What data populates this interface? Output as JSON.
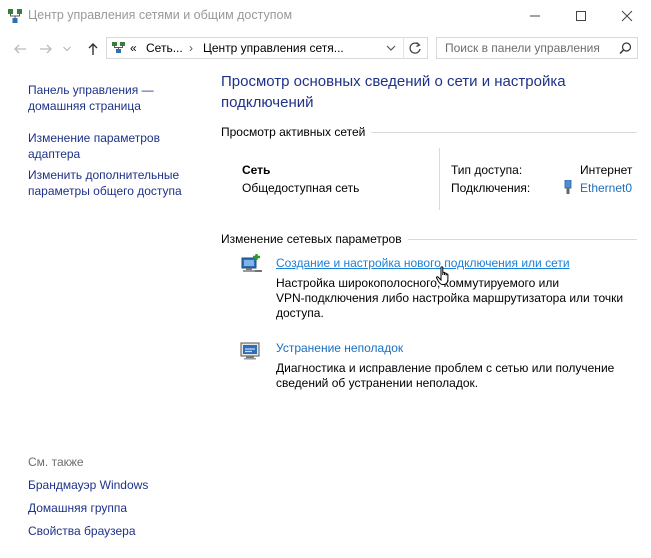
{
  "window": {
    "title": "Центр управления сетями и общим доступом",
    "icons": {
      "app": "network-center-icon",
      "minimize": "minimize-icon",
      "maximize": "maximize-icon",
      "close": "close-icon"
    }
  },
  "navigation": {
    "breadcrumb_overflow": "«",
    "breadcrumb": [
      "Сеть...",
      "Центр управления сетя..."
    ],
    "separator": "›",
    "search_placeholder": "Поиск в панели управления"
  },
  "left_pane": {
    "links": [
      {
        "label_line1": "Панель управления —",
        "label_line2": "домашняя страница"
      },
      {
        "label_line1": "Изменение параметров",
        "label_line2": "адаптера"
      },
      {
        "label_line1": "Изменить дополнительные",
        "label_line2": "параметры общего доступа"
      }
    ],
    "see_also_title": "См. также",
    "see_also": [
      "Брандмауэр Windows",
      "Домашняя группа",
      "Свойства браузера"
    ]
  },
  "main": {
    "heading_line1": "Просмотр основных сведений о сети и настройка",
    "heading_line2": "подключений",
    "active_networks": {
      "title": "Просмотр активных сетей",
      "network_name": "Сеть",
      "network_type": "Общедоступная сеть",
      "access_type_label": "Тип доступа:",
      "access_type_value": "Интернет",
      "connections_label": "Подключения:",
      "connections_value": "Ethernet0"
    },
    "change_settings": {
      "title": "Изменение сетевых параметров",
      "tasks": [
        {
          "link": "Создание и настройка нового подключения или сети",
          "desc_line1": "Настройка широкополосного, коммутируемого или",
          "desc_line2": "VPN-подключения либо настройка маршрутизатора или точки",
          "desc_line3": "доступа."
        },
        {
          "link": "Устранение неполадок",
          "desc_line1": "Диагностика и исправление проблем с сетью или получение",
          "desc_line2": "сведений об устранении неполадок."
        }
      ]
    }
  },
  "colors": {
    "link": "#1a6fbf",
    "heading": "#1e3287",
    "nav_link": "#1e3287"
  }
}
